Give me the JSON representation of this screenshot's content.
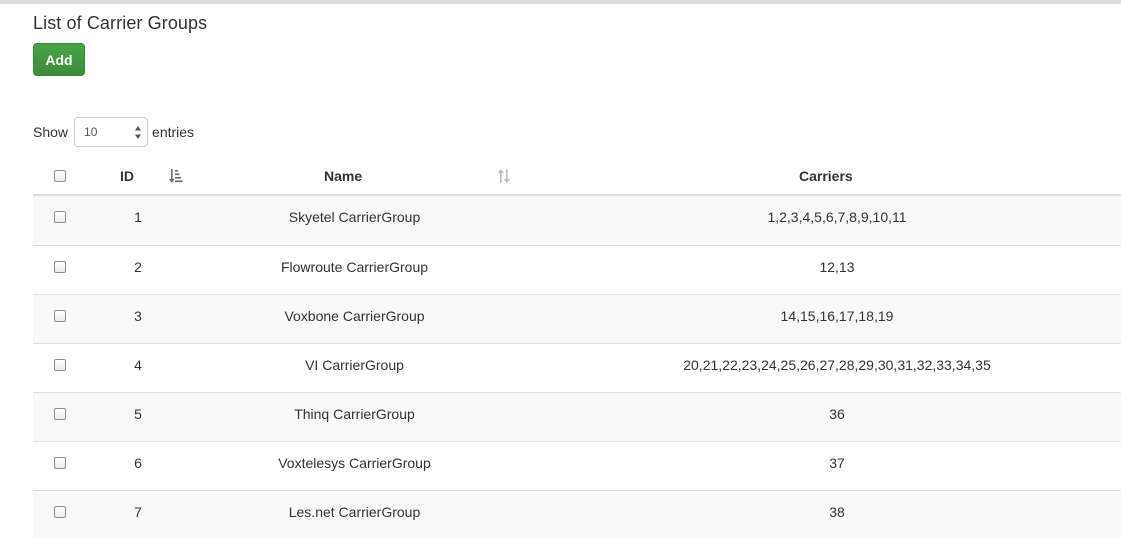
{
  "page": {
    "title": "List of Carrier Groups",
    "add_label": "Add"
  },
  "length_menu": {
    "show_label": "Show",
    "selected": "10",
    "entries_label": "entries"
  },
  "table": {
    "columns": {
      "id": "ID",
      "name": "Name",
      "carriers": "Carriers"
    },
    "rows": [
      {
        "id": "1",
        "name": "Skyetel CarrierGroup",
        "carriers": "1,2,3,4,5,6,7,8,9,10,11"
      },
      {
        "id": "2",
        "name": "Flowroute CarrierGroup",
        "carriers": "12,13"
      },
      {
        "id": "3",
        "name": "Voxbone CarrierGroup",
        "carriers": "14,15,16,17,18,19"
      },
      {
        "id": "4",
        "name": "VI CarrierGroup",
        "carriers": "20,21,22,23,24,25,26,27,28,29,30,31,32,33,34,35"
      },
      {
        "id": "5",
        "name": "Thinq CarrierGroup",
        "carriers": "36"
      },
      {
        "id": "6",
        "name": "Voxtelesys CarrierGroup",
        "carriers": "37"
      },
      {
        "id": "7",
        "name": "Les.net CarrierGroup",
        "carriers": "38"
      }
    ]
  },
  "colors": {
    "add_button": "#47a447",
    "stripe": "#f9f9f9",
    "border": "#dddddd"
  },
  "icons": {
    "id_sort": "sort-ascending-icon",
    "name_sort": "sort-both-icon",
    "select": "select-arrows-icon"
  }
}
